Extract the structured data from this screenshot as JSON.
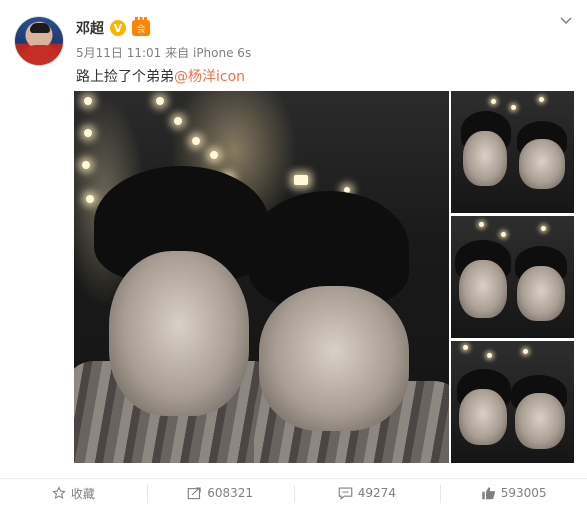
{
  "post": {
    "username": "邓超",
    "verified_badge": "V",
    "member_badge": "会",
    "time": "5月11日 11:01",
    "source_prefix": "来自",
    "source": "iPhone 6s",
    "text": "路上捡了个弟弟",
    "mention": "@杨洋icon"
  },
  "actions": {
    "favorite_label": "收藏",
    "share_count": "608321",
    "comment_count": "49274",
    "like_count": "593005"
  },
  "icons": {
    "menu": "chevron-down-icon",
    "favorite": "star-icon",
    "share": "share-icon",
    "comment": "comment-icon",
    "like": "thumbs-up-icon"
  },
  "colors": {
    "mention": "#eb7350",
    "meta": "#808080",
    "verified": "#f7b500",
    "member": "#ff8200"
  }
}
